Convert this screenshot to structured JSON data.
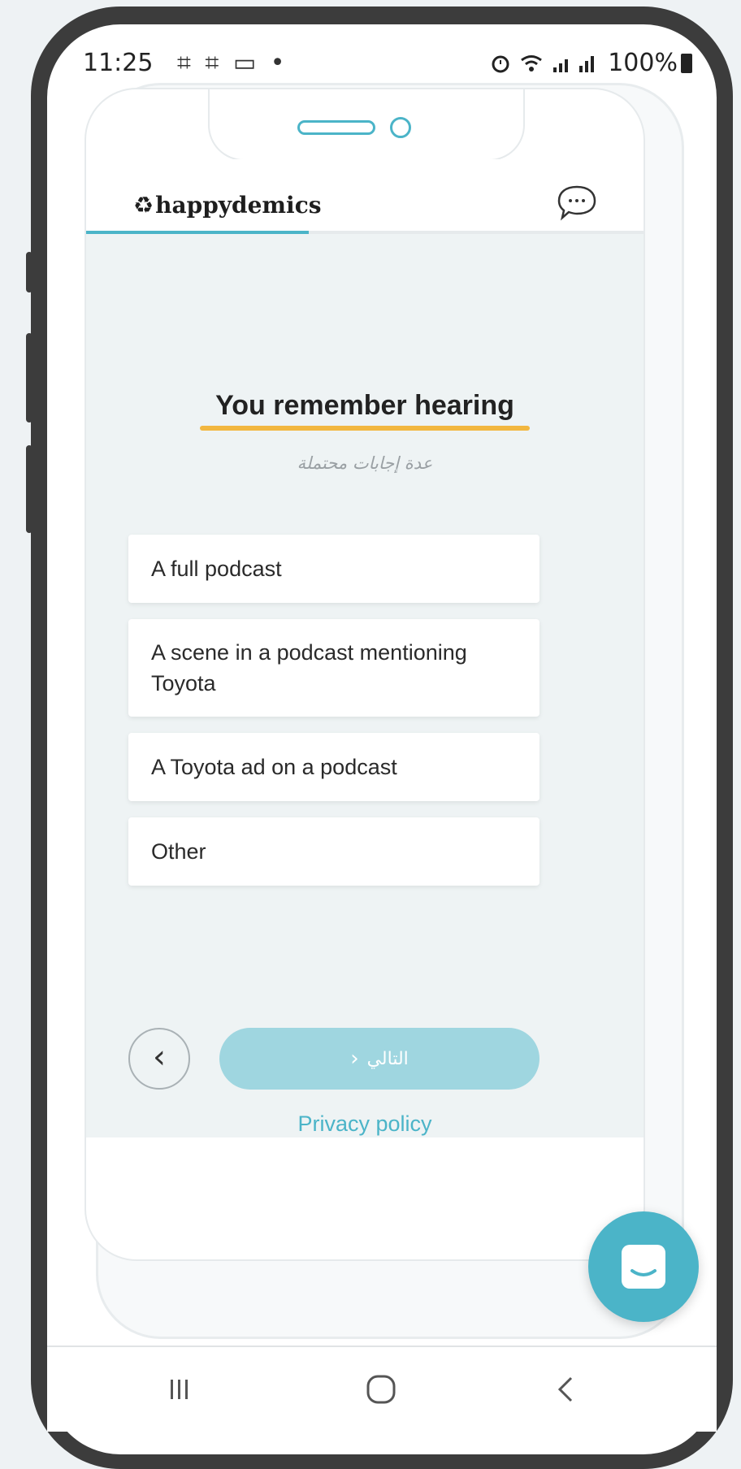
{
  "status_bar": {
    "time": "11:25",
    "left_icons": "⌗ ⌗ ▭ •",
    "right_text": "100%"
  },
  "app": {
    "logo_mark": "♻",
    "logo_text": "happydemics",
    "progress": 0.4
  },
  "question": {
    "title": "You remember hearing",
    "subtitle": "عدة إجابات محتملة",
    "options": [
      {
        "label": "A full podcast"
      },
      {
        "label": "A scene in a podcast mentioning Toyota"
      },
      {
        "label": "A Toyota ad on a podcast"
      },
      {
        "label": "Other"
      }
    ]
  },
  "navigation": {
    "back_symbol": "‹",
    "next_label": "التالي",
    "next_symbol": "›",
    "privacy_label": "Privacy policy"
  },
  "colors": {
    "accent": "#4bb4c8",
    "highlight": "#f2b740",
    "next_disabled": "#9fd6e0"
  },
  "icons": {
    "chat": "chat-bubble-icon",
    "fab": "messenger-chat-icon",
    "nav_recents": "recents-icon",
    "nav_home": "home-icon",
    "nav_back": "back-icon"
  }
}
